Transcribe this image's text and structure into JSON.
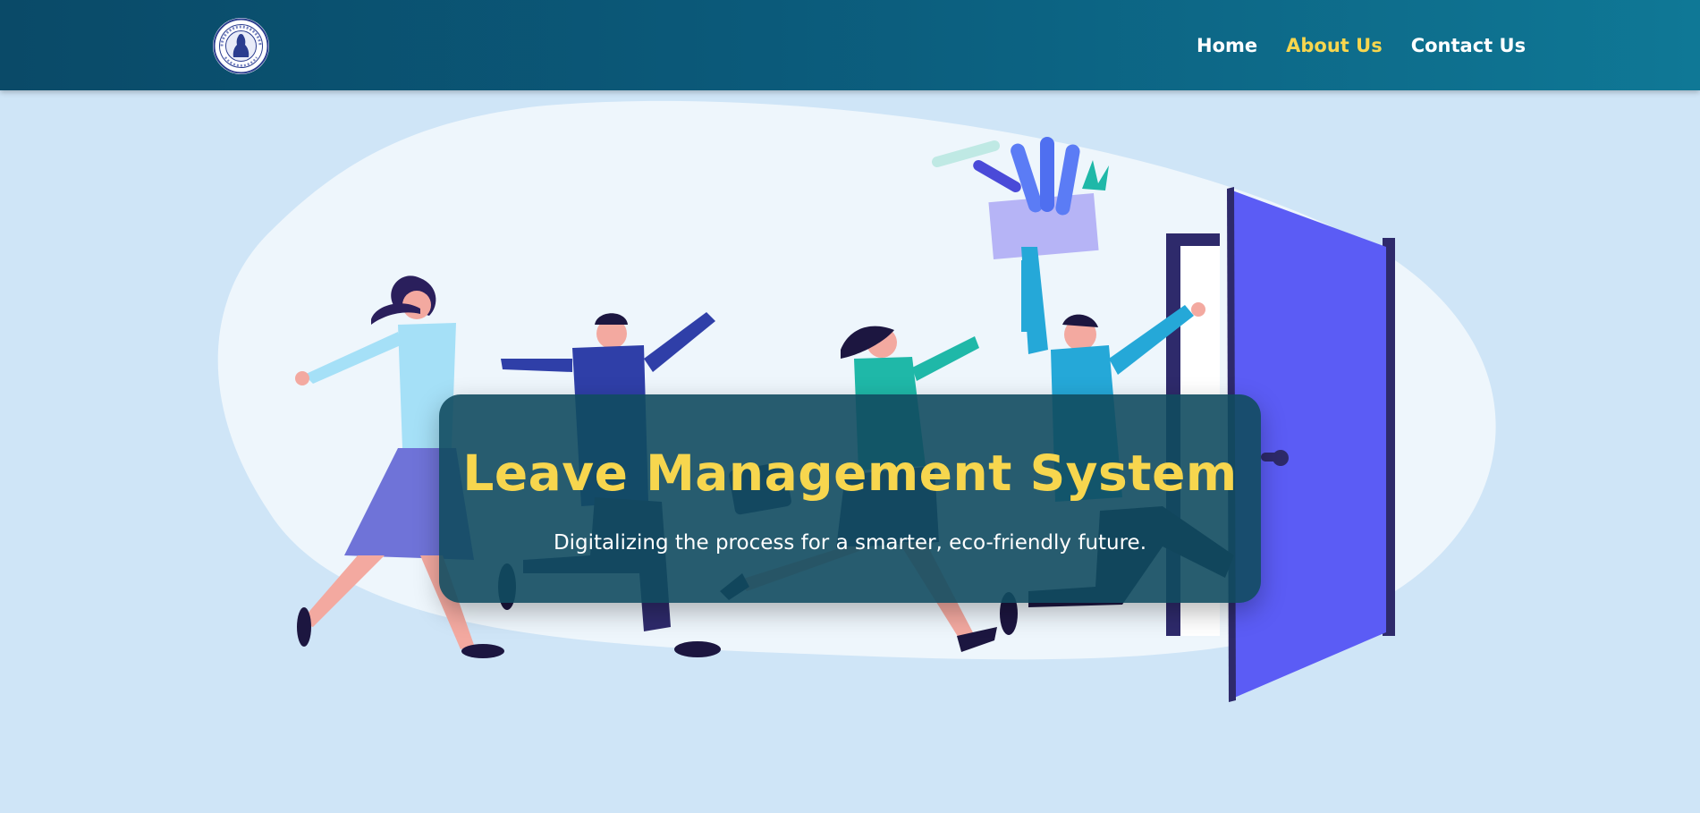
{
  "navbar": {
    "logo_alt": "Institution emblem",
    "links": [
      {
        "label": "Home",
        "active": false
      },
      {
        "label": "About Us",
        "active": true
      },
      {
        "label": "Contact Us",
        "active": false
      }
    ],
    "active_color": "#f7d64e"
  },
  "hero": {
    "title": "Leave Management System",
    "subtitle": "Digitalizing the process for a smarter, eco-friendly future.",
    "illustration": "people-running-out-door-illustration"
  },
  "colors": {
    "nav_start": "#0a4a68",
    "nav_end": "#0f7896",
    "page_background": "#cfe5f7",
    "title": "#f7d64e",
    "door": "#5b5cf5"
  }
}
